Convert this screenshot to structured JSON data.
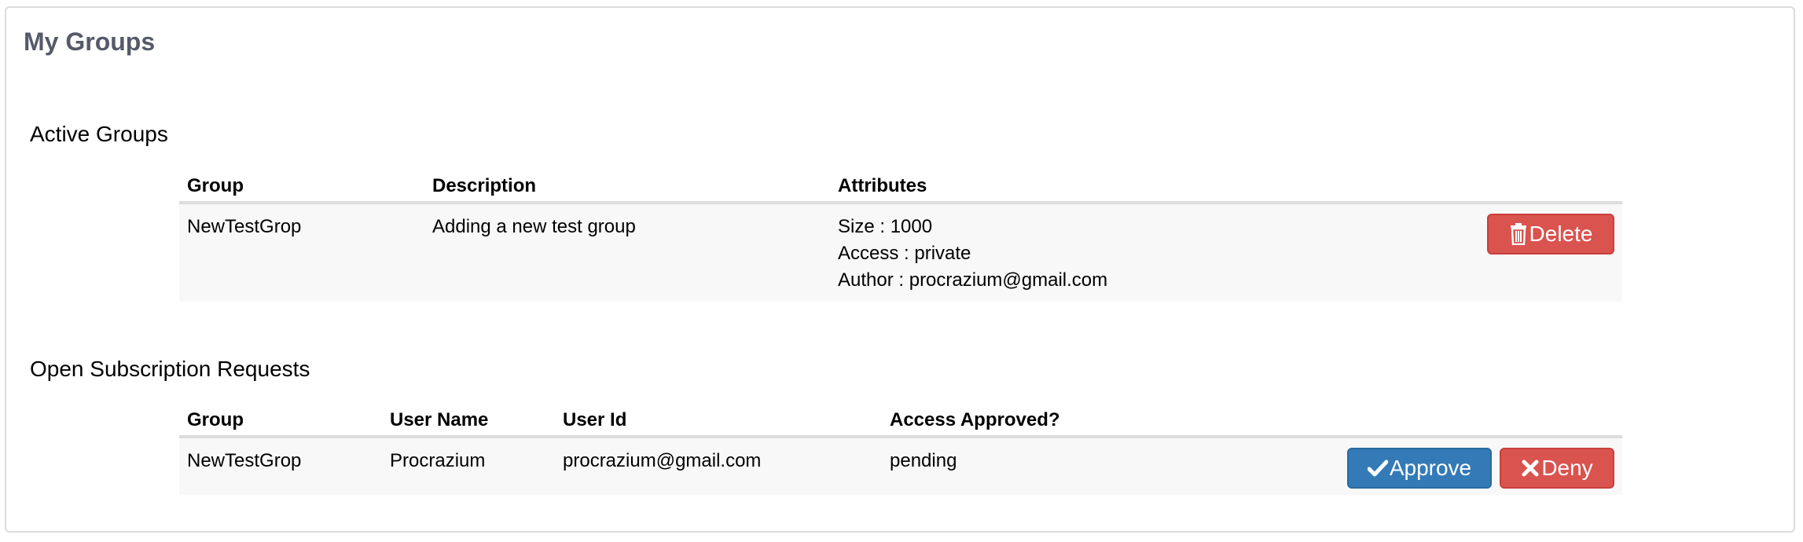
{
  "page": {
    "title": "My Groups"
  },
  "active_groups": {
    "title": "Active Groups",
    "headers": {
      "group": "Group",
      "description": "Description",
      "attributes": "Attributes"
    },
    "rows": [
      {
        "group": "NewTestGrop",
        "description": "Adding a new test group",
        "size": "Size : 1000",
        "access": "Access : private",
        "author": "Author : procrazium@gmail.com",
        "delete_label": "Delete"
      }
    ]
  },
  "subscription_requests": {
    "title": "Open Subscription Requests",
    "headers": {
      "group": "Group",
      "user_name": "User Name",
      "user_id": "User Id",
      "access_approved": "Access Approved?"
    },
    "rows": [
      {
        "group": "NewTestGrop",
        "user_name": "Procrazium",
        "user_id": "procrazium@gmail.com",
        "access_approved": "pending",
        "approve_label": "Approve",
        "deny_label": "Deny"
      }
    ]
  },
  "icons": {
    "delete": "trash-icon",
    "approve": "checkmark-icon",
    "deny": "x-icon"
  },
  "colors": {
    "danger": "#d9534f",
    "primary": "#337ab7",
    "title": "#55596a",
    "row_background": "#f8f8f8"
  }
}
